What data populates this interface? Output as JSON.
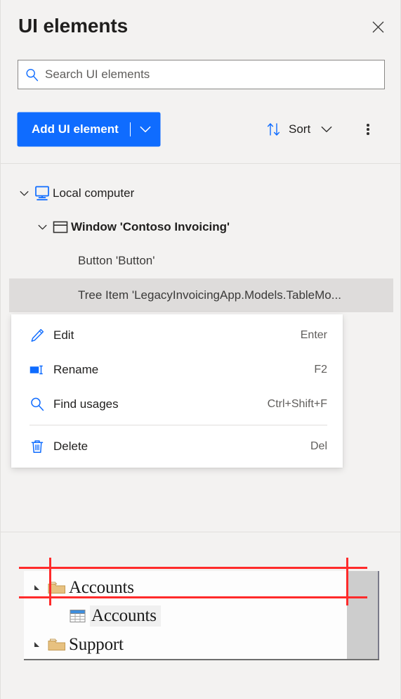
{
  "panel": {
    "title": "UI elements",
    "close_icon": "close-icon"
  },
  "search": {
    "placeholder": "Search UI elements",
    "value": "",
    "icon": "search-icon"
  },
  "toolbar": {
    "add_label": "Add UI element",
    "add_caret_icon": "chevron-down-icon",
    "sort_label": "Sort",
    "sort_icon": "sort-arrows-icon",
    "sort_caret_icon": "chevron-down-icon",
    "more_icon": "more-vertical-icon",
    "accent_color": "#0f6cff"
  },
  "tree": {
    "items": [
      {
        "label": "Local computer",
        "icon": "monitor-icon",
        "chevron": "chevron-down-icon",
        "depth": 0,
        "bold": false,
        "selected": false
      },
      {
        "label": "Window 'Contoso Invoicing'",
        "icon": "window-icon",
        "chevron": "chevron-down-icon",
        "depth": 1,
        "bold": true,
        "selected": false
      },
      {
        "label": "Button 'Button'",
        "icon": "",
        "chevron": "",
        "depth": 2,
        "bold": false,
        "selected": false
      },
      {
        "label": "Tree Item 'LegacyInvoicingApp.Models.TableMo...",
        "icon": "",
        "chevron": "",
        "depth": 2,
        "bold": false,
        "selected": true
      }
    ]
  },
  "context_menu": {
    "items": [
      {
        "label": "Edit",
        "shortcut": "Enter",
        "icon": "pencil-icon",
        "separator_after": false
      },
      {
        "label": "Rename",
        "shortcut": "F2",
        "icon": "rename-icon",
        "separator_after": false
      },
      {
        "label": "Find usages",
        "shortcut": "Ctrl+Shift+F",
        "icon": "search-icon",
        "separator_after": true
      },
      {
        "label": "Delete",
        "shortcut": "Del",
        "icon": "trash-icon",
        "separator_after": false
      }
    ]
  },
  "preview": {
    "rows": [
      {
        "label": "Accounts",
        "icon": "folder-icon",
        "arrow": "expand-arrow-icon"
      },
      {
        "label": "Accounts",
        "icon": "table-icon",
        "arrow": ""
      },
      {
        "label": "Support",
        "icon": "folder-icon",
        "arrow": "expand-arrow-icon"
      }
    ],
    "highlight_color": "#ff2b2b"
  }
}
